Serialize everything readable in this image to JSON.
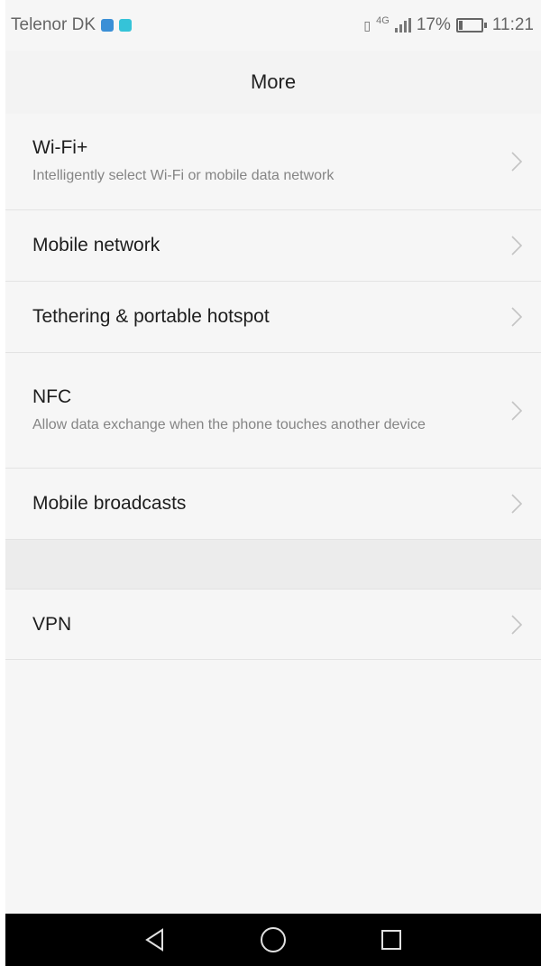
{
  "status": {
    "carrier": "Telenor DK",
    "network": "4G",
    "battery": "17%",
    "battery_level": 0.17,
    "time": "11:21"
  },
  "header": {
    "title": "More"
  },
  "items": [
    {
      "title": "Wi-Fi+",
      "subtitle": "Intelligently select Wi-Fi or mobile data network"
    },
    {
      "title": "Mobile network"
    },
    {
      "title": "Tethering & portable hotspot"
    },
    {
      "title": "NFC",
      "subtitle": "Allow data exchange when the phone touches another device"
    },
    {
      "title": "Mobile broadcasts"
    },
    {
      "title": "VPN"
    }
  ],
  "icons": {
    "chevron": "chevron-right-icon",
    "back": "back-triangle-icon",
    "home": "home-circle-icon",
    "recents": "recents-square-icon"
  },
  "colors": {
    "background": "#f6f6f6",
    "divider": "#e3e3e3",
    "navbar": "#000000",
    "accent_a": "#3a8fd6",
    "accent_b": "#35c3d8"
  }
}
